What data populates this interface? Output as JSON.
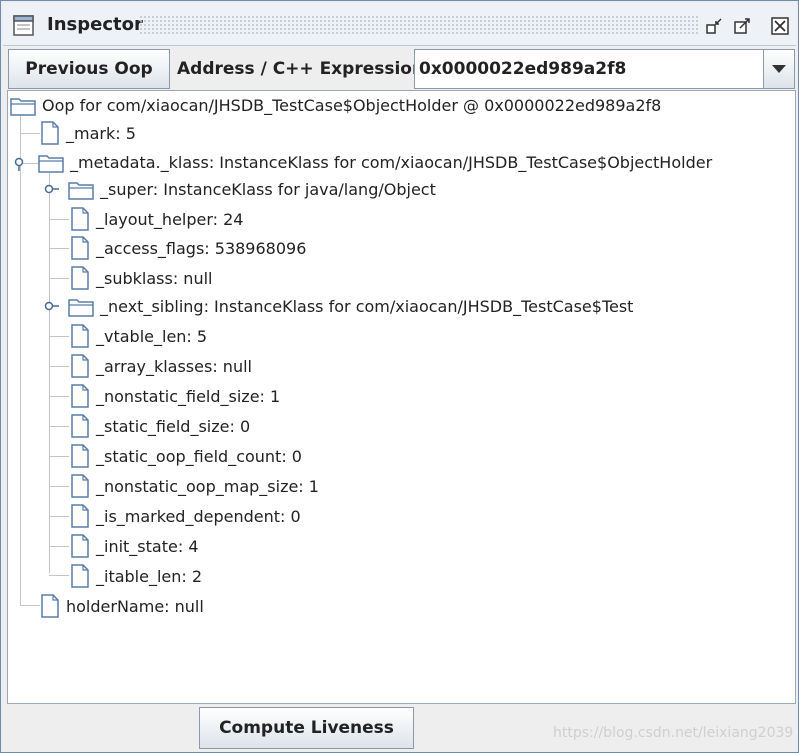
{
  "window": {
    "title": "Inspector",
    "icons": [
      "window-app-icon",
      "minimize-icon",
      "maximize-icon",
      "close-icon"
    ]
  },
  "toolbar": {
    "previous_label": "Previous Oop",
    "address_label": "Address / C++ Expression:",
    "address_value": "0x0000022ed989a2f8"
  },
  "tree": {
    "root": "Oop for com/xiaocan/JHSDB_TestCase$ObjectHolder @ 0x0000022ed989a2f8",
    "mark": "_mark: 5",
    "metadata": "_metadata._klass: InstanceKlass for com/xiaocan/JHSDB_TestCase$ObjectHolder",
    "super": "_super: InstanceKlass for java/lang/Object",
    "layout_helper": "_layout_helper: 24",
    "access_flags": "_access_flags: 538968096",
    "subklass": "_subklass: null",
    "next_sibling": "_next_sibling: InstanceKlass for com/xiaocan/JHSDB_TestCase$Test",
    "vtable_len": "_vtable_len: 5",
    "array_klasses": "_array_klasses: null",
    "nonstatic_field_size": "_nonstatic_field_size: 1",
    "static_field_size": "_static_field_size: 0",
    "static_oop_field_count": "_static_oop_field_count: 0",
    "nonstatic_oop_map_size": "_nonstatic_oop_map_size: 1",
    "is_marked_dependent": "_is_marked_dependent: 0",
    "init_state": "_init_state: 4",
    "itable_len": "_itable_len: 2",
    "holder_name": "holderName: null"
  },
  "bottom": {
    "compute_label": "Compute Liveness"
  },
  "watermark": "https://blog.csdn.net/leixiang2039"
}
